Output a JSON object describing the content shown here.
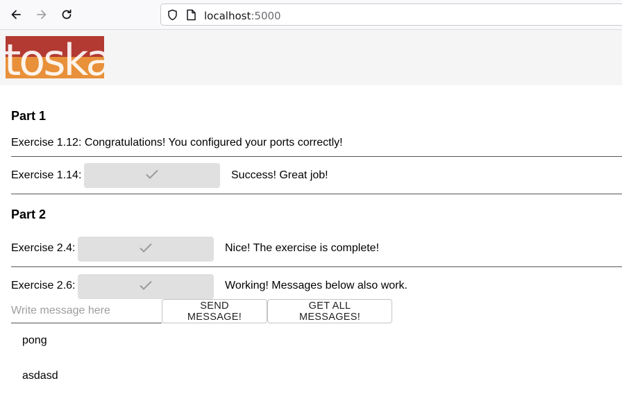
{
  "browser": {
    "url_host": "localhost",
    "url_port": ":5000"
  },
  "colors": {
    "logo_red": "#b33a32",
    "logo_orange": "#e8913a"
  },
  "logo_text": "toska",
  "part1": {
    "heading": "Part 1",
    "ex112": "Exercise 1.12: Congratulations! You configured your ports correctly!",
    "ex114_label": "Exercise 1.14:",
    "ex114_status": "Success! Great job!"
  },
  "part2": {
    "heading": "Part 2",
    "ex24_label": "Exercise 2.4:",
    "ex24_status": "Nice! The exercise is complete!",
    "ex26_label": "Exercise 2.6:",
    "ex26_status": "Working! Messages below also work.",
    "message_placeholder": "Write message here",
    "send_button": "SEND MESSAGE!",
    "get_button": "GET ALL MESSAGES!",
    "messages": [
      "pong",
      "asdasd"
    ]
  }
}
